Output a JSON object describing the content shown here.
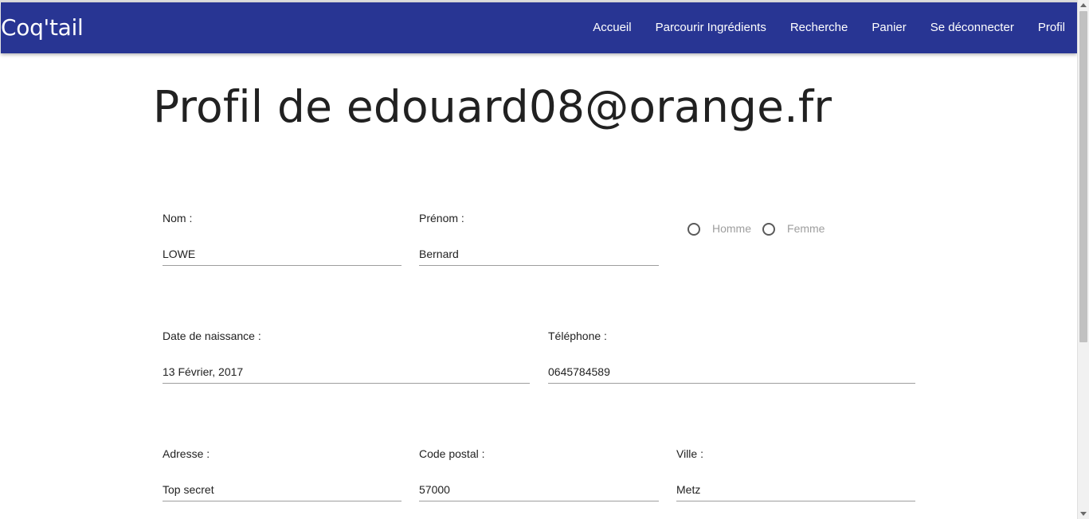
{
  "navbar": {
    "brand": "Coq'tail",
    "links": [
      "Accueil",
      "Parcourir Ingrédients",
      "Recherche",
      "Panier",
      "Se déconnecter",
      "Profil"
    ],
    "color": "#283593"
  },
  "page_title": "Profil de edouard08@orange.fr",
  "form": {
    "nom": {
      "label": "Nom :",
      "value": "LOWE"
    },
    "prenom": {
      "label": "Prénom :",
      "value": "Bernard"
    },
    "sexe": {
      "options": [
        "Homme",
        "Femme"
      ],
      "selected": null
    },
    "date_naissance": {
      "label": "Date de naissance :",
      "value": "13 Février, 2017"
    },
    "telephone": {
      "label": "Téléphone :",
      "value": "0645784589"
    },
    "adresse": {
      "label": "Adresse :",
      "value": "Top secret"
    },
    "code_postal": {
      "label": "Code postal :",
      "value": "57000"
    },
    "ville": {
      "label": "Ville :",
      "value": "Metz"
    }
  }
}
